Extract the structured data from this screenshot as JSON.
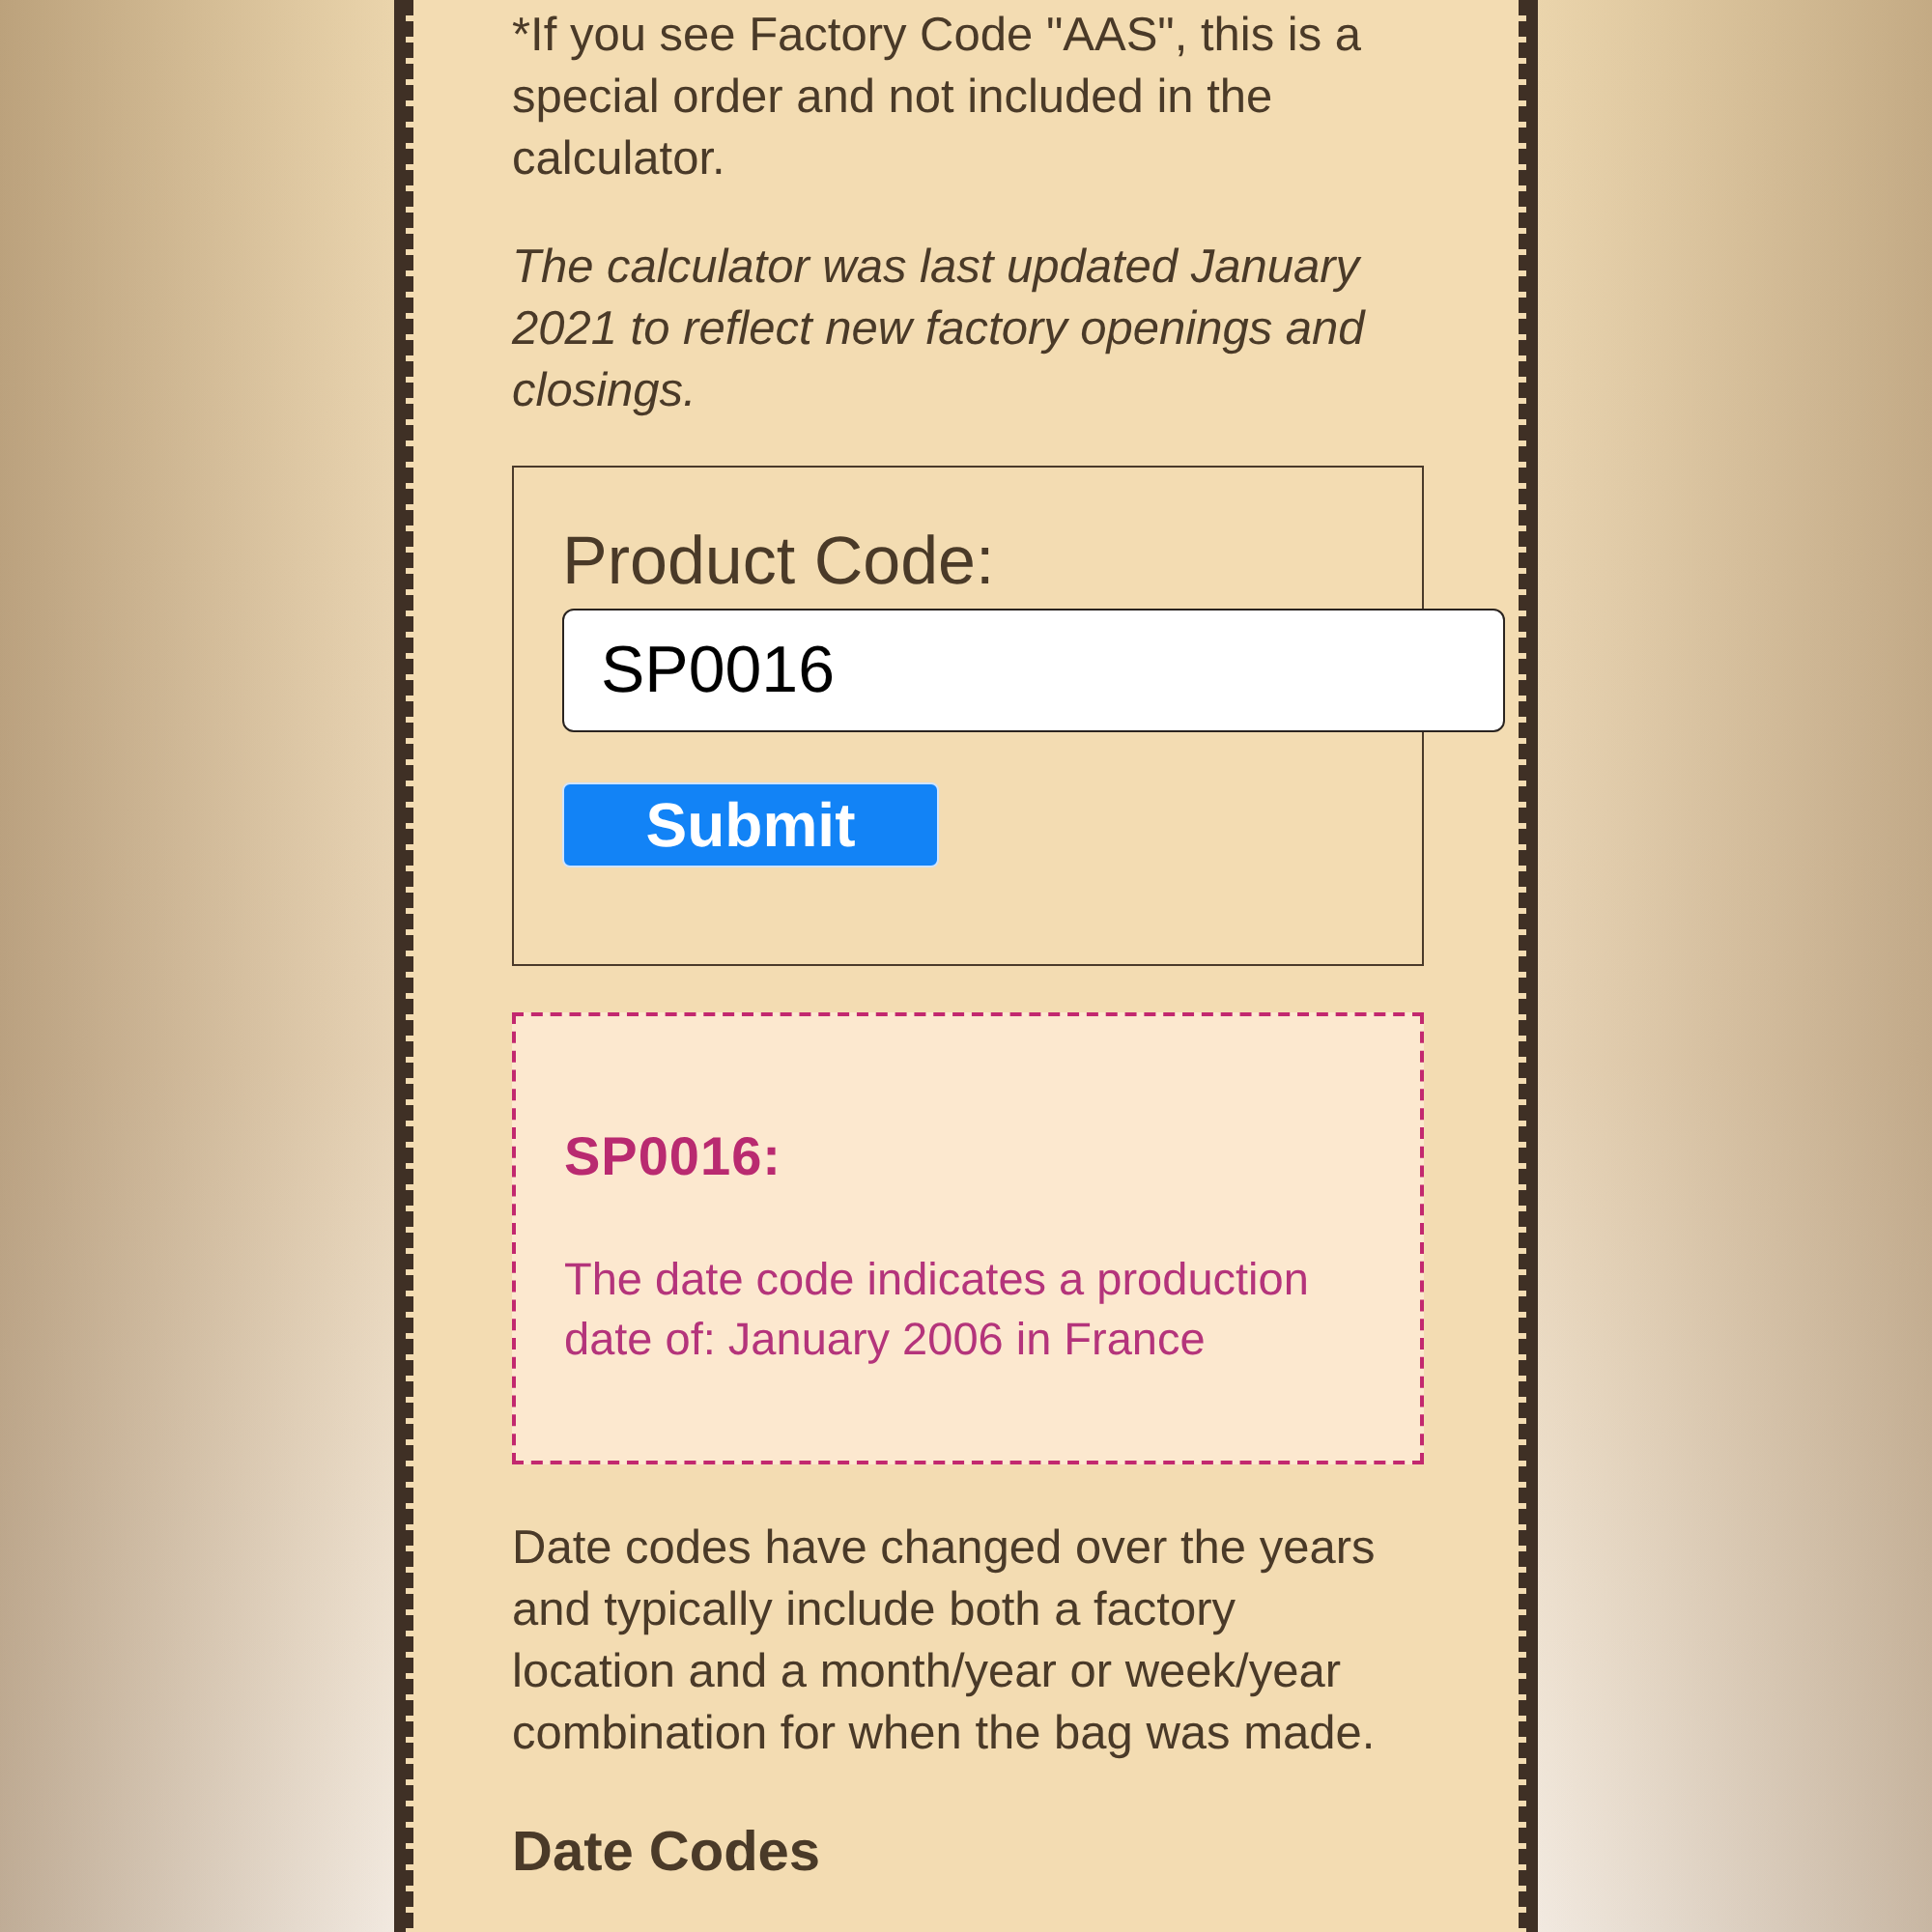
{
  "notes": [
    {
      "kind": "footnote",
      "text": "*If you see Factory Code \"AAS\", this is a special order and not included in the calculator."
    },
    {
      "kind": "notice",
      "text": "The calculator was last updated January 2021 to reflect new factory openings and closings."
    }
  ],
  "form": {
    "label": "Product Code:",
    "input": {
      "value": "SP0016"
    },
    "submit_button": "Submit"
  },
  "result": {
    "code": "SP0016:",
    "message": "The date code indicates a production date of: January 2006 in France"
  },
  "description": "Date codes have changed over the years and typically include both a factory location and a month/year or week/year combination for when the bag was made.",
  "section_heading": "Date Codes"
}
